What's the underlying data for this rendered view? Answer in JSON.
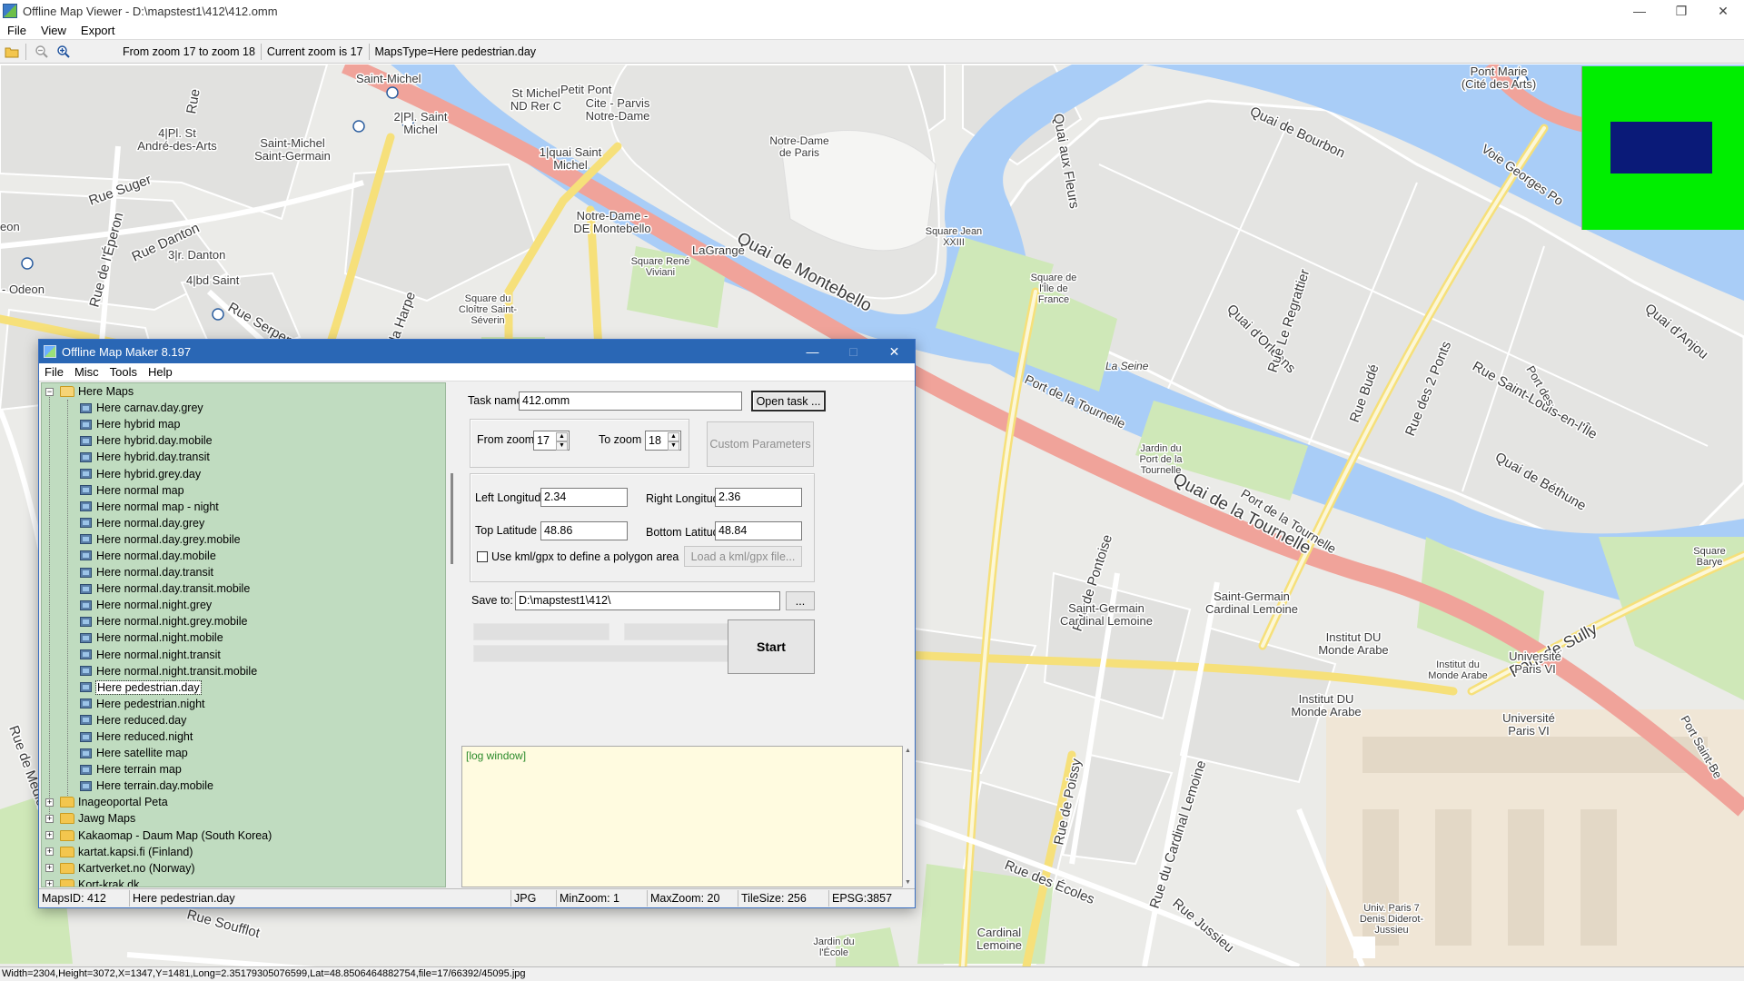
{
  "viewer": {
    "title": "Offline Map Viewer - D:\\mapstest1\\412\\412.omm",
    "menu": [
      "File",
      "View",
      "Export"
    ],
    "zoom_range": "From zoom 17 to zoom 18",
    "current_zoom": "Current zoom is 17",
    "maps_type": "MapsType=Here pedestrian.day",
    "coord_status": "Width=2304,Height=3072,X=1347,Y=1481,Long=2.35179305076599,Lat=48.8506464882754,file=17/66392/45095.jpg"
  },
  "map_labels": {
    "quai_montebello": "Quai de Montebello",
    "quai_tournelle": "Quai de la Tournelle",
    "quai_fleurs": "Quai aux Fleurs",
    "quai_bourbon": "Quai de Bourbon",
    "quai_orleans": "Quai d'Orléans",
    "quai_bethune": "Quai de Béthune",
    "quai_anjou": "Quai d'Anjou",
    "port_tournelle_1": "Port de la Tournelle",
    "port_tournelle_2": "Port de la Tournelle",
    "la_seine": "La Seine",
    "pont_sully": "Pont de Sully",
    "rue_des_2_ponts": "Rue des 2 Ponts",
    "rue_saint_louis": "Rue Saint-Louis-en-l'Île",
    "rue_budé": "Rue Budé",
    "rue_regrattier": "Rue Le Regrattier",
    "voie_georges": "Voie Georges Po",
    "pont_marie": "Pont Marie\n(Cité des Arts)",
    "notre_dame": "Notre-Dame\nde Paris",
    "square_jean_xxiii": "Square Jean\nXXIII",
    "square_ile_de_france": "Square de\nl'Île de\nFrance",
    "jardin_tournelle": "Jardin du\nPort de la\nTournelle",
    "rue_suger": "Rue Suger",
    "rue_danton": "Rue Danton",
    "rue_serpente": "Rue Serpente",
    "rue_eperon": "Rue de l'Éperon",
    "rue_harpe": "Rue de la Harpe",
    "rue_pontoise": "Rue de Pontoise",
    "rue_poissy": "Rue de Poissy",
    "rue_cardinal_lemoine": "Rue du Cardinal Lemoine",
    "rue_ecoles": "Rue des Écoles",
    "rue_jussieu": "Rue Jussieu",
    "rue_soufflot": "Rue Soufflot",
    "rue_medicis": "Rue de Médicis",
    "rue_saint_bernard": "Port Saint-Be",
    "saint_michel": "Saint-Michel",
    "st_michel_nd": "St Michel\nND Rer C",
    "cite_parvis": "Cite - Parvis\nNotre-Dame",
    "pl_st": "4|Pl. St\nAndré-des-Arts",
    "pl_saint_michel": "2|Pl. Saint\nMichel",
    "quai_saint_michel": "1|quai Saint\nMichel",
    "saint_michel_saint_germain": "Saint-Michel\nSaint-Germain",
    "notre_dame_montebello": "Notre-Dame -\nDE Montebello",
    "petit_pont": "Petit Pont",
    "square_rene_viviani": "Square René\nViviani",
    "lagrange": "LaGrange",
    "square_cloitre": "Square du\nCloître Saint-\nSéverin",
    "rue_danton_3": "3|r. Danton",
    "bd_saint": "4|bd Saint",
    "odeon": "- Odeon",
    "saint_germain_lemoine_1": "Saint-Germain\nCardinal Lemoine",
    "saint_germain_lemoine_2": "Saint-Germain\nCardinal Lemoine",
    "institut_monde_arabe_1": "Institut DU\nMonde Arabe",
    "institut_monde_arabe_2": "Institut du\nMonde Arabe",
    "institut_monde_arabe_3": "Institut DU\nMonde Arabe",
    "univ_paris_vi_1": "Université\nParis VI",
    "univ_paris_vi_2": "Université\nParis VI",
    "univ_paris_7": "Univ. Paris 7\nDenis Diderot-\nJussieu",
    "cardinal_lemoine": "Cardinal\nLemoine",
    "jardin_ecole": "Jardin du\nl'École",
    "square_barye": "Square\nBarye",
    "port_des": "Port des",
    "rue": "Rue",
    "eon": "eon"
  },
  "dialog": {
    "title": "Offline Map Maker 8.197",
    "menu": [
      "File",
      "Misc",
      "Tools",
      "Help"
    ],
    "tree": {
      "root": "Here Maps",
      "children": [
        "Here carnav.day.grey",
        "Here hybrid map",
        "Here hybrid.day.mobile",
        "Here hybrid.day.transit",
        "Here hybrid.grey.day",
        "Here normal map",
        "Here normal map - night",
        "Here normal.day.grey",
        "Here normal.day.grey.mobile",
        "Here normal.day.mobile",
        "Here normal.day.transit",
        "Here normal.day.transit.mobile",
        "Here normal.night.grey",
        "Here normal.night.grey.mobile",
        "Here normal.night.mobile",
        "Here normal.night.transit",
        "Here normal.night.transit.mobile",
        "Here pedestrian.day",
        "Here pedestrian.night",
        "Here reduced.day",
        "Here reduced.night",
        "Here satellite map",
        "Here terrain map",
        "Here terrain.day.mobile"
      ],
      "selected": "Here pedestrian.day",
      "siblings": [
        "Inageoportal Peta",
        "Jawg Maps",
        "Kakaomap - Daum Map (South Korea)",
        "kartat.kapsi.fi (Finland)",
        "Kartverket.no (Norway)",
        "Kort-krak.dk"
      ]
    },
    "task_name_label": "Task name",
    "task_name_value": "412.omm",
    "open_task_label": "Open task ...",
    "from_zoom_label": "From zoom",
    "from_zoom_value": "17",
    "to_zoom_label": "To zoom",
    "to_zoom_value": "18",
    "custom_params_label": "Custom Parameters",
    "left_lon_label": "Left Longitude",
    "left_lon_value": "2.34",
    "right_lon_label": "Right Longitude",
    "right_lon_value": "2.36",
    "top_lat_label": "Top Latitude",
    "top_lat_value": "48.86",
    "bottom_lat_label": "Bottom Latitude",
    "bottom_lat_value": "48.84",
    "kml_label": "Use kml/gpx to define a polygon area",
    "kml_checked": false,
    "load_kml_label": "Load a kml/gpx file...",
    "save_to_label": "Save to:",
    "save_to_value": "D:\\mapstest1\\412\\",
    "browse_label": "...",
    "start_label": "Start",
    "log_text": "[log window]",
    "status": {
      "maps_id": "MapsID: 412",
      "maps_name": "Here pedestrian.day",
      "format": "JPG",
      "min_zoom": "MinZoom: 1",
      "max_zoom": "MaxZoom: 20",
      "tile_size": "TileSize: 256",
      "epsg": "EPSG:3857"
    }
  },
  "colors": {
    "river": "#a9cdf7",
    "major_road": "#f0a39a",
    "yellow_road": "#f6e07a",
    "park": "#cfe8b8",
    "tree_bg": "#c0dcc0",
    "log_bg": "#fffbe0",
    "minimap_bg": "#00ee00",
    "minimap_view": "#0a1a78",
    "dialog_title": "#2a67b5"
  }
}
